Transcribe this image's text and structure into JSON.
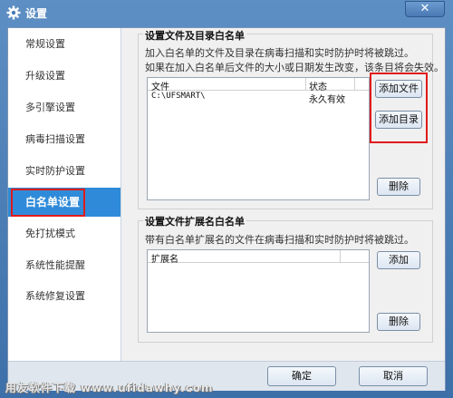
{
  "window": {
    "title": "设置",
    "close_glyph": "✕"
  },
  "sidebar": {
    "items": [
      {
        "label": "常规设置"
      },
      {
        "label": "升级设置"
      },
      {
        "label": "多引擎设置"
      },
      {
        "label": "病毒扫描设置"
      },
      {
        "label": "实时防护设置"
      },
      {
        "label": "白名单设置",
        "active": true
      },
      {
        "label": "免打扰模式"
      },
      {
        "label": "系统性能提醒"
      },
      {
        "label": "系统修复设置"
      }
    ]
  },
  "files_group": {
    "title": "设置文件及目录白名单",
    "desc1": "加入白名单的文件及目录在病毒扫描和实时防护时将被跳过。",
    "desc2": "如果在加入白名单后文件的大小或日期发生改变，该条目将会失效。",
    "columns": {
      "file": "文件",
      "status": "状态"
    },
    "rows": [
      {
        "file": "C:\\UFSMART\\",
        "status": "永久有效"
      }
    ],
    "add_file_label": "添加文件",
    "add_dir_label": "添加目录",
    "delete_label": "删除"
  },
  "ext_group": {
    "title": "设置文件扩展名白名单",
    "desc": "带有白名单扩展名的文件在病毒扫描和实时防护时将被跳过。",
    "column": "扩展名",
    "add_label": "添加",
    "delete_label": "删除"
  },
  "footer": {
    "ok_label": "确定",
    "cancel_label": "取消"
  },
  "watermark": "用友软件下载 www.ufidawhy.com",
  "colors": {
    "accent": "#2f8bd9",
    "highlight": "#e01b1b",
    "title_bar": "#4a7bb5"
  }
}
